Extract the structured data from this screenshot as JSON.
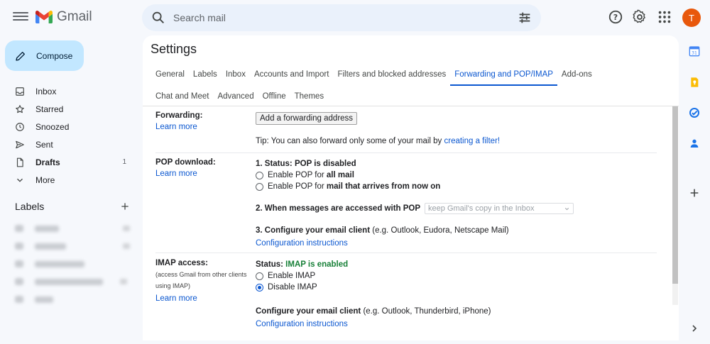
{
  "app": {
    "name": "Gmail"
  },
  "search": {
    "placeholder": "Search mail"
  },
  "account": {
    "initial": "T"
  },
  "compose": {
    "label": "Compose"
  },
  "nav": {
    "items": [
      {
        "label": "Inbox",
        "icon": "inbox-icon",
        "count": ""
      },
      {
        "label": "Starred",
        "icon": "star-icon",
        "count": ""
      },
      {
        "label": "Snoozed",
        "icon": "clock-icon",
        "count": ""
      },
      {
        "label": "Sent",
        "icon": "send-icon",
        "count": ""
      },
      {
        "label": "Drafts",
        "icon": "draft-icon",
        "count": "1"
      },
      {
        "label": "More",
        "icon": "chevron-down-icon",
        "count": ""
      }
    ],
    "labels_heading": "Labels"
  },
  "settings": {
    "title": "Settings",
    "tabs_row1": [
      "General",
      "Labels",
      "Inbox",
      "Accounts and Import",
      "Filters and blocked addresses",
      "Forwarding and POP/IMAP",
      "Add-ons"
    ],
    "tabs_row2": [
      "Chat and Meet",
      "Advanced",
      "Offline",
      "Themes"
    ],
    "active_tab": "Forwarding and POP/IMAP",
    "forwarding": {
      "label": "Forwarding:",
      "learn_more": "Learn more",
      "add_button": "Add a forwarding address",
      "tip_prefix": "Tip: You can also forward only some of your mail by ",
      "tip_link": "creating a filter!"
    },
    "pop": {
      "label": "POP download:",
      "learn_more": "Learn more",
      "status_prefix": "1. Status: POP is disabled",
      "option1_prefix": "Enable POP for ",
      "option1_bold": "all mail",
      "option2_prefix": "Enable POP for ",
      "option2_bold": "mail that arrives from now on",
      "when_label": "2. When messages are accessed with POP",
      "when_select": "keep Gmail's copy in the Inbox",
      "configure_bold": "3. Configure your email client",
      "configure_rest": " (e.g. Outlook, Eudora, Netscape Mail)",
      "instructions": "Configuration instructions"
    },
    "imap": {
      "label": "IMAP access:",
      "sub": "(access Gmail from other clients using IMAP)",
      "learn_more": "Learn more",
      "status_prefix": "Status: ",
      "status_value": "IMAP is enabled",
      "option1": "Enable IMAP",
      "option2": "Disable IMAP",
      "selected": "Disable IMAP",
      "configure_bold": "Configure your email client",
      "configure_rest": " (e.g. Outlook, Thunderbird, iPhone)",
      "instructions": "Configuration instructions"
    }
  },
  "colors": {
    "accent": "#0b57d0",
    "compose_bg": "#c2e7ff",
    "search_bg": "#eaf1fb",
    "enabled_green": "#188038",
    "avatar": "#e8580c"
  }
}
